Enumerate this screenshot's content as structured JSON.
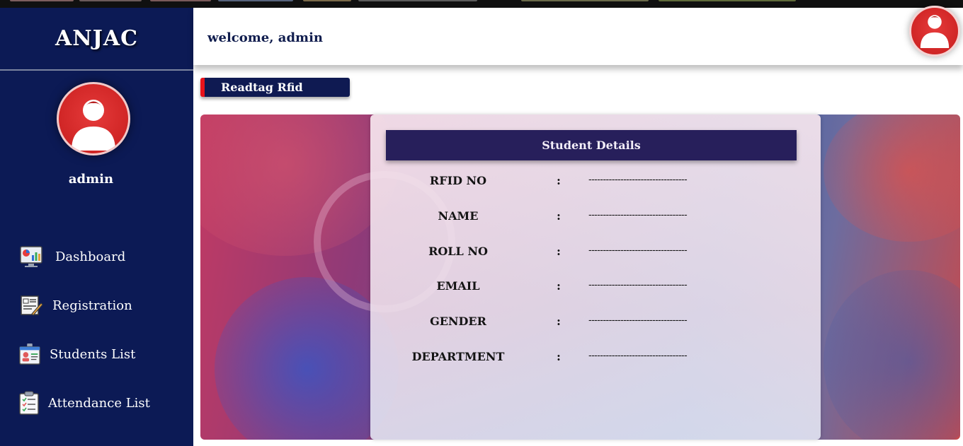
{
  "app": {
    "brand": "ANJAC"
  },
  "sidebar": {
    "username": "admin",
    "items": [
      {
        "label": "Dashboard",
        "icon": "dashboard-chart-icon"
      },
      {
        "label": "Registration",
        "icon": "registration-form-icon"
      },
      {
        "label": "Students List",
        "icon": "id-card-icon"
      },
      {
        "label": "Attendance List",
        "icon": "clipboard-icon"
      }
    ]
  },
  "header": {
    "welcome": "welcome, admin"
  },
  "action": {
    "label": "Readtag Rfid"
  },
  "student_details": {
    "title": "Student Details",
    "fields": [
      {
        "label": "RFID NO",
        "value": "----------------------------------"
      },
      {
        "label": "NAME",
        "value": "----------------------------------"
      },
      {
        "label": "ROLL NO",
        "value": "----------------------------------"
      },
      {
        "label": "EMAIL",
        "value": "----------------------------------"
      },
      {
        "label": "GENDER",
        "value": "----------------------------------"
      },
      {
        "label": "DEPARTMENT",
        "value": "----------------------------------"
      }
    ],
    "separator": ":"
  },
  "colors": {
    "sidebar": "#0c1a55",
    "accent": "#e8131b",
    "card_header": "#271f5b",
    "avatar": "#d32828"
  }
}
